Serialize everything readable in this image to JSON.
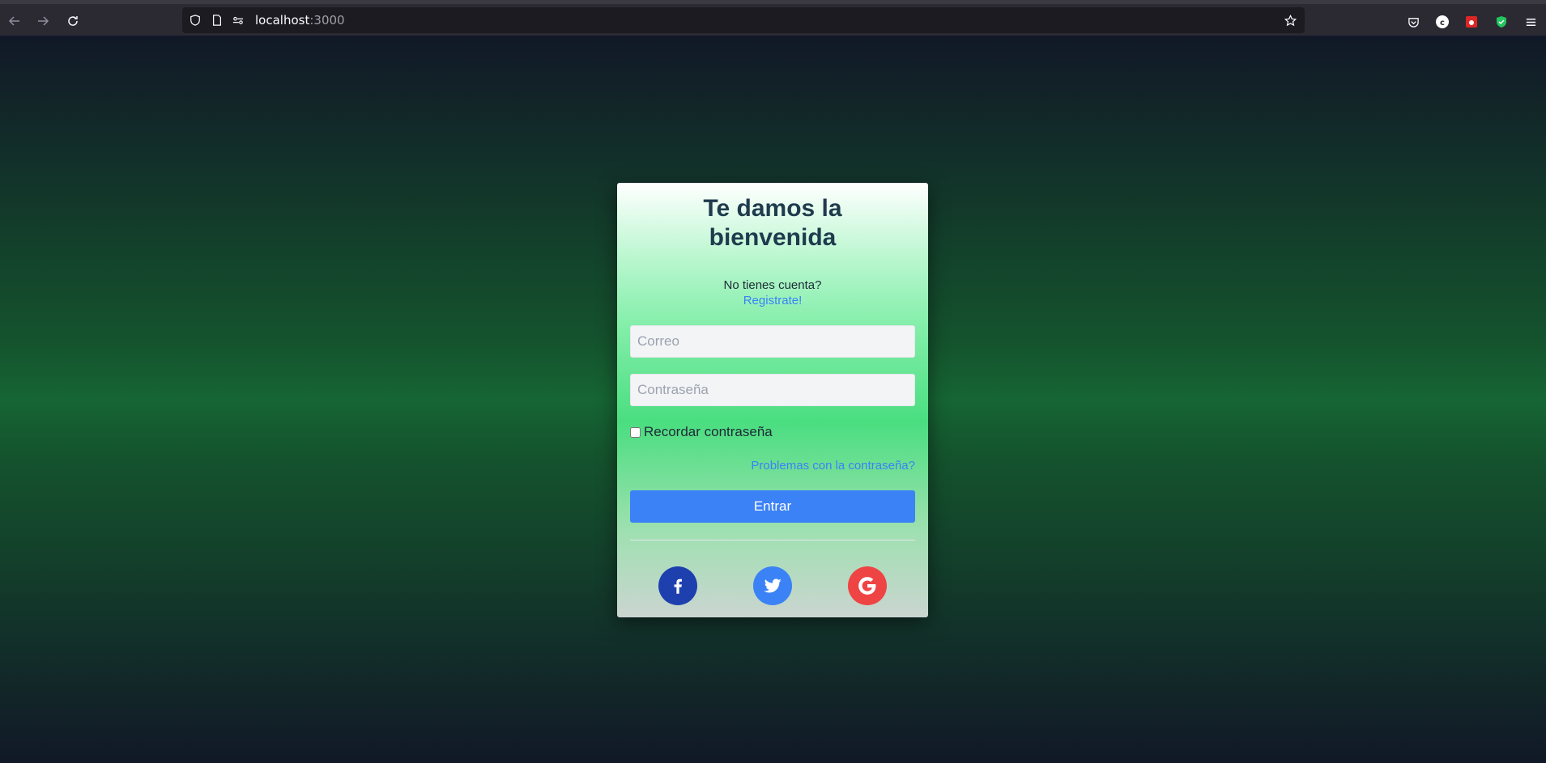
{
  "browser": {
    "url_host": "localhost",
    "url_port": ":3000",
    "icons": [
      "back-arrow-icon",
      "forward-arrow-icon",
      "reload-icon",
      "shield-icon",
      "page-icon",
      "permissions-icon",
      "bookmark-star-icon",
      "pocket-icon",
      "extension-c-icon",
      "extension-red-icon",
      "extension-green-shield-icon",
      "menu-icon"
    ]
  },
  "login": {
    "title": "Te damos la bienvenida",
    "no_account_text": "No tienes cuenta?",
    "register_link": "Registrate!",
    "email_placeholder": "Correo",
    "password_placeholder": "Contraseña",
    "remember_label": "Recordar contraseña",
    "forgot_link": "Problemas con la contraseña?",
    "submit_label": "Entrar",
    "social": [
      {
        "name": "facebook",
        "icon": "facebook-icon",
        "color": "#1e40af"
      },
      {
        "name": "twitter",
        "icon": "twitter-icon",
        "color": "#3b82f6"
      },
      {
        "name": "google",
        "icon": "google-icon",
        "color": "#ef4444"
      }
    ]
  },
  "colors": {
    "accent": "#3b82f6",
    "background_dark": "#111827",
    "background_green": "#166534"
  }
}
